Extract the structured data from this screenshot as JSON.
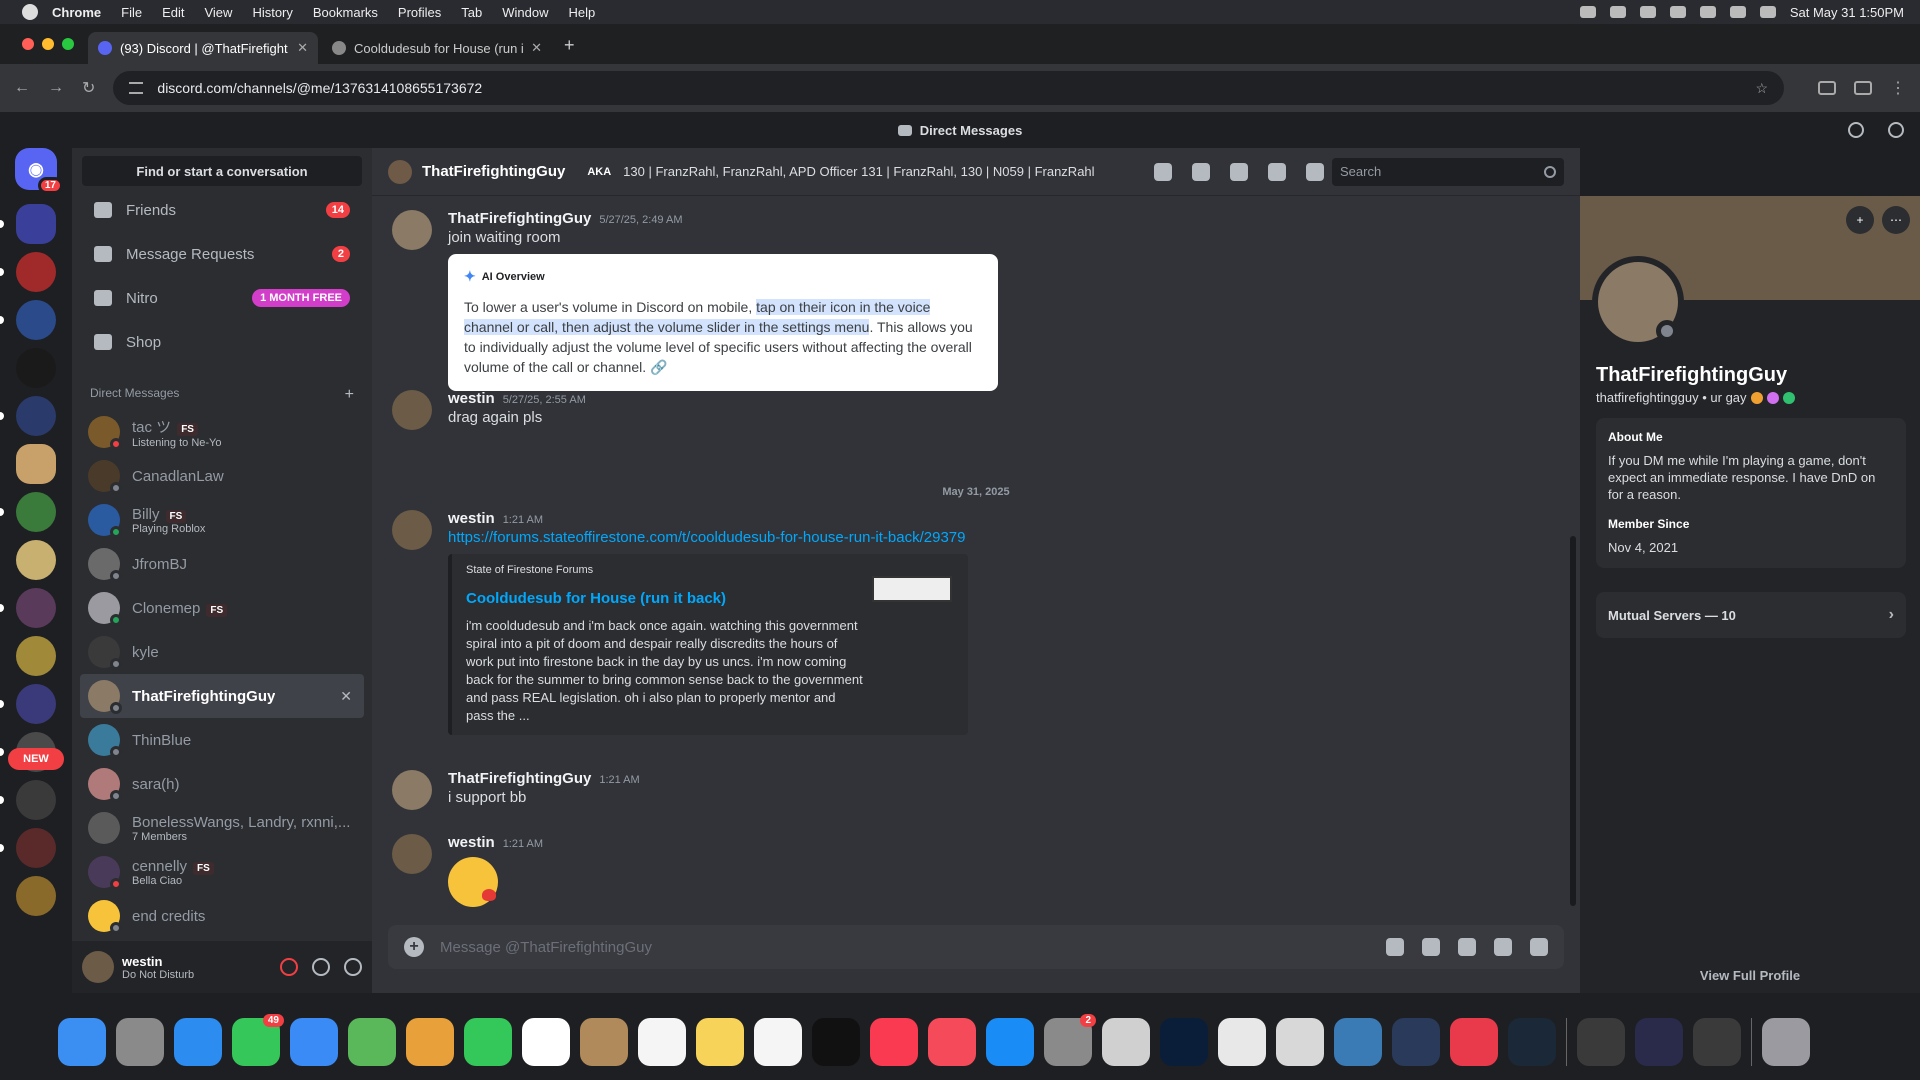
{
  "menubar": {
    "app": "Chrome",
    "items": [
      "File",
      "Edit",
      "View",
      "History",
      "Bookmarks",
      "Profiles",
      "Tab",
      "Window",
      "Help"
    ],
    "datetime": "Sat May 31  1:50PM"
  },
  "tabs": [
    {
      "title": "(93) Discord | @ThatFirefight",
      "active": true
    },
    {
      "title": "Cooldudesub for House (run i",
      "active": false
    }
  ],
  "address": {
    "url": "discord.com/channels/@me/1376314108655173672"
  },
  "titlebar": {
    "title": "Direct Messages"
  },
  "guilds": {
    "home_badge": "17",
    "new_label": "NEW"
  },
  "sidebar": {
    "search_placeholder": "Find or start a conversation",
    "nav": [
      {
        "label": "Friends",
        "badge": "14",
        "icon": "friends-icon"
      },
      {
        "label": "Message Requests",
        "badge": "2",
        "icon": "envelope-icon"
      },
      {
        "label": "Nitro",
        "badge": "1 MONTH FREE",
        "icon": "nitro-icon"
      },
      {
        "label": "Shop",
        "badge": "",
        "icon": "shop-icon"
      }
    ],
    "dm_header": "Direct Messages",
    "dms": [
      {
        "name": "tac ツ",
        "tag": "FS",
        "sub": "Listening to Ne-Yo",
        "status": "dnd",
        "color": "#7a5a2a"
      },
      {
        "name": "CanadlanLaw",
        "tag": "",
        "sub": "",
        "status": "off",
        "color": "#4a3a2a"
      },
      {
        "name": "Billy",
        "tag": "FS",
        "sub": "Playing Roblox",
        "status": "on",
        "color": "#2a5aa0"
      },
      {
        "name": "JfromBJ",
        "tag": "",
        "sub": "",
        "status": "off",
        "color": "#6a6a6a"
      },
      {
        "name": "Clonemep",
        "tag": "FS",
        "sub": "",
        "status": "on",
        "color": "#9a9aa0"
      },
      {
        "name": "kyle",
        "tag": "",
        "sub": "",
        "status": "off",
        "color": "#3a3a3a"
      },
      {
        "name": "ThatFirefightingGuy",
        "tag": "",
        "sub": "",
        "status": "off",
        "color": "#8a7a66",
        "selected": true
      },
      {
        "name": "ThinBlue",
        "tag": "",
        "sub": "",
        "status": "off",
        "color": "#3a7a9a"
      },
      {
        "name": "sara(h)",
        "tag": "",
        "sub": "",
        "status": "off",
        "color": "#b07a7a"
      },
      {
        "name": "BonelessWangs, Landry, rxnni,...",
        "tag": "",
        "sub": "7 Members",
        "status": "group",
        "color": "#5a5a5a"
      },
      {
        "name": "cennelly",
        "tag": "FS",
        "sub": "Bella Ciao",
        "status": "dnd",
        "color": "#4a3a5a"
      },
      {
        "name": "end credits",
        "tag": "",
        "sub": "",
        "status": "off",
        "color": "#f6c33b"
      }
    ],
    "user": {
      "name": "westin",
      "status": "Do Not Disturb"
    }
  },
  "chat": {
    "recipient": "ThatFirefightingGuy",
    "aka_label": "AKA",
    "aka": "130 | FranzRahl, FranzRahl, APD Officer 131 | FranzRahl, 130 | N059 | FranzRahl",
    "search_placeholder": "Search",
    "date_divider": "May 31, 2025",
    "composer_placeholder": "Message @ThatFirefightingGuy",
    "messages": [
      {
        "author": "ThatFirefightingGuy",
        "time": "5/27/25, 2:49 AM",
        "text": "join waiting room"
      },
      {
        "author": "westin",
        "time": "5/27/25, 2:55 AM",
        "text": "drag again pls"
      },
      {
        "author": "westin",
        "time": "1:21 AM",
        "link": "https://forums.stateoffirestone.com/t/cooldudesub-for-house-run-it-back/29379"
      },
      {
        "author": "ThatFirefightingGuy",
        "time": "1:21 AM",
        "text": "i support bb"
      },
      {
        "author": "westin",
        "time": "1:21 AM",
        "emoji": "kissing-heart-emoji"
      }
    ],
    "ai_overview": {
      "header": "AI Overview",
      "before": "To lower a user's volume in Discord on mobile, ",
      "highlight": "tap on their icon in the voice channel or call, then adjust the volume slider in the settings menu",
      "after": ". This allows you to individually adjust the volume level of specific users without affecting the overall volume of the call or channel."
    },
    "embed": {
      "provider": "State of Firestone Forums",
      "title": "Cooldudesub for House (run it back)",
      "description": "i'm cooldudesub and i'm back once again. watching this government spiral into a pit of doom and despair really discredits the hours of work put into firestone back in the day by us uncs. i'm now coming back for the summer to bring common sense back to the government and pass REAL legislation. oh i also plan to properly mentor and pass the ..."
    }
  },
  "profile": {
    "name": "ThatFirefightingGuy",
    "handle": "thatfirefightingguy • ur gay",
    "about_header": "About Me",
    "about": "If you DM me while I'm playing a game, don't expect an immediate response. I have DnD on for a reason.",
    "member_since_header": "Member Since",
    "member_since": "Nov 4, 2021",
    "mutual": "Mutual Servers — 10",
    "view_full": "View Full Profile"
  },
  "dock": {
    "apps": [
      {
        "name": "finder",
        "color": "#3b8ff3"
      },
      {
        "name": "launchpad",
        "color": "#8a8a8a"
      },
      {
        "name": "safari",
        "color": "#2c8cf0"
      },
      {
        "name": "messages",
        "color": "#35c759",
        "badge": "49"
      },
      {
        "name": "mail",
        "color": "#3a8bf5"
      },
      {
        "name": "maps",
        "color": "#5ab85a"
      },
      {
        "name": "photos",
        "color": "#e8a03a"
      },
      {
        "name": "facetime",
        "color": "#34c759"
      },
      {
        "name": "calendar",
        "color": "#ffffff"
      },
      {
        "name": "contacts",
        "color": "#b08a5a"
      },
      {
        "name": "reminders",
        "color": "#f5f5f5"
      },
      {
        "name": "notes",
        "color": "#f7d35a"
      },
      {
        "name": "freeform",
        "color": "#f5f5f5"
      },
      {
        "name": "tv",
        "color": "#111111"
      },
      {
        "name": "music",
        "color": "#fa3a50"
      },
      {
        "name": "news",
        "color": "#f54a5a"
      },
      {
        "name": "app-store",
        "color": "#1a8cf5"
      },
      {
        "name": "system-settings",
        "color": "#8a8a8a",
        "badge": "2"
      },
      {
        "name": "iphone-mirroring",
        "color": "#d0d0d0"
      },
      {
        "name": "photoshop",
        "color": "#0a1e3a"
      },
      {
        "name": "chrome",
        "color": "#e8e8e8"
      },
      {
        "name": "roblox",
        "color": "#d8d8d8"
      },
      {
        "name": "roblox-studio",
        "color": "#3a7ab5"
      },
      {
        "name": "quicktime",
        "color": "#2a3a5a"
      },
      {
        "name": "creative-cloud",
        "color": "#e83a4a"
      },
      {
        "name": "steam",
        "color": "#1b2838"
      },
      {
        "name": "window-1",
        "color": "#3a3a3a"
      },
      {
        "name": "window-2",
        "color": "#2a2a4a"
      },
      {
        "name": "window-3",
        "color": "#3a3a3a"
      },
      {
        "name": "trash",
        "color": "#9a9aa0"
      }
    ]
  }
}
